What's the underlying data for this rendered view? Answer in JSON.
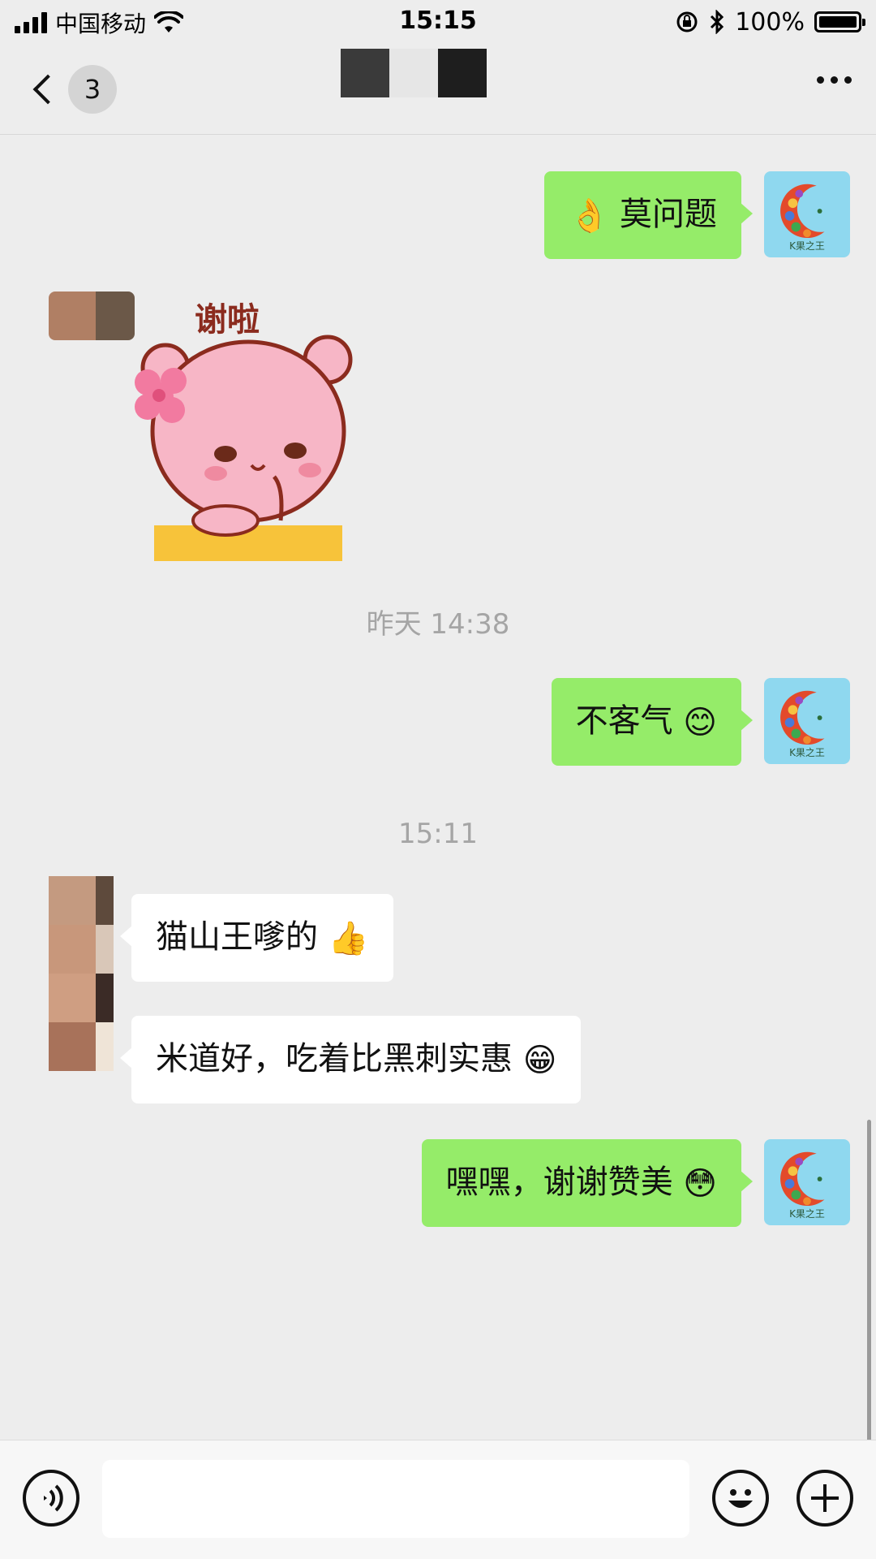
{
  "status": {
    "carrier": "中国移动",
    "time": "15:15",
    "battery": "100%"
  },
  "nav": {
    "unread_count": "3"
  },
  "messages": [
    {
      "side": "self",
      "text": "莫问题",
      "emoji_before": "👌"
    },
    {
      "side": "other",
      "type": "sticker",
      "sticker_text": "谢啦"
    },
    {
      "type": "time",
      "text": "昨天 14:38"
    },
    {
      "side": "self",
      "text": "不客气",
      "emoji_after": "😊"
    },
    {
      "type": "time",
      "text": "15:11"
    },
    {
      "side": "other",
      "text": "猫山王嗲的",
      "emoji_after": "👍"
    },
    {
      "side": "other",
      "text": "米道好，吃着比黑刺实惠",
      "emoji_after": "😁"
    },
    {
      "side": "self",
      "text": "嘿嘿，谢谢赞美",
      "emoji_after": "😳"
    }
  ],
  "self_avatar": {
    "logo_text": "K果之王"
  },
  "colors": {
    "self_bubble": "#95ec69",
    "other_bubble": "#ffffff",
    "background": "#ededed",
    "avatar_bg": "#8fd8ef"
  },
  "icons": {
    "back": "chevron-left-icon",
    "more": "more-dots-icon",
    "voice": "voice-icon",
    "emoji": "emoji-icon",
    "plus": "plus-icon"
  }
}
